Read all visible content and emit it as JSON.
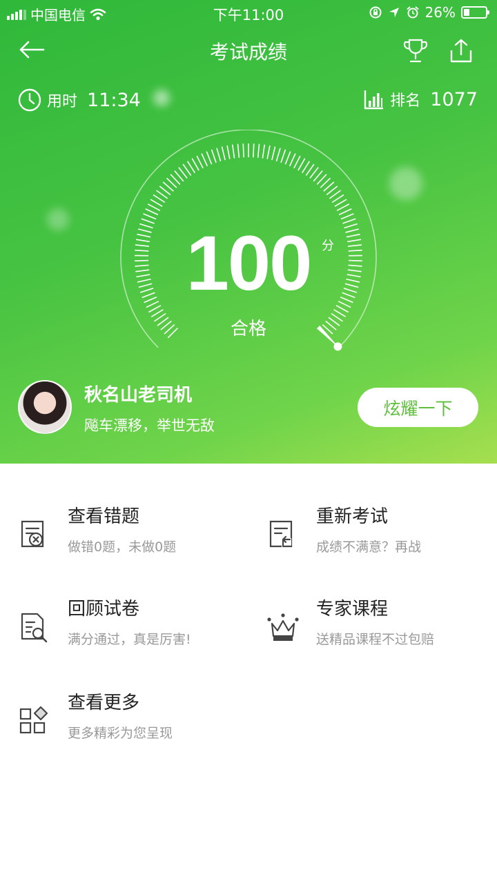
{
  "status_bar": {
    "carrier": "中国电信",
    "time": "下午11:00",
    "battery": "26%",
    "battery_level": 0.26
  },
  "nav": {
    "title": "考试成绩"
  },
  "stats": {
    "time_label": "用时",
    "time_value": "11:34",
    "rank_label": "排名",
    "rank_value": "1077"
  },
  "result": {
    "score": "100",
    "unit": "分",
    "verdict": "合格",
    "score_fraction": 1.0
  },
  "user": {
    "name": "秋名山老司机",
    "motto": "飚车漂移，举世无敌"
  },
  "share_button": "炫耀一下",
  "menu": [
    {
      "title": "查看错题",
      "subtitle": "做错0题，未做0题",
      "icon": "wrong-questions-icon"
    },
    {
      "title": "重新考试",
      "subtitle": "成绩不满意？再战",
      "icon": "retake-exam-icon"
    },
    {
      "title": "回顾试卷",
      "subtitle": "满分通过，真是厉害!",
      "icon": "review-paper-icon"
    },
    {
      "title": "专家课程",
      "subtitle": "送精品课程不过包赔",
      "icon": "crown-icon"
    },
    {
      "title": "查看更多",
      "subtitle": "更多精彩为您呈现",
      "icon": "more-apps-icon"
    }
  ],
  "colors": {
    "hero_green": "#47c342",
    "accent_green": "#5dbe3a",
    "subtitle_gray": "#999999"
  }
}
